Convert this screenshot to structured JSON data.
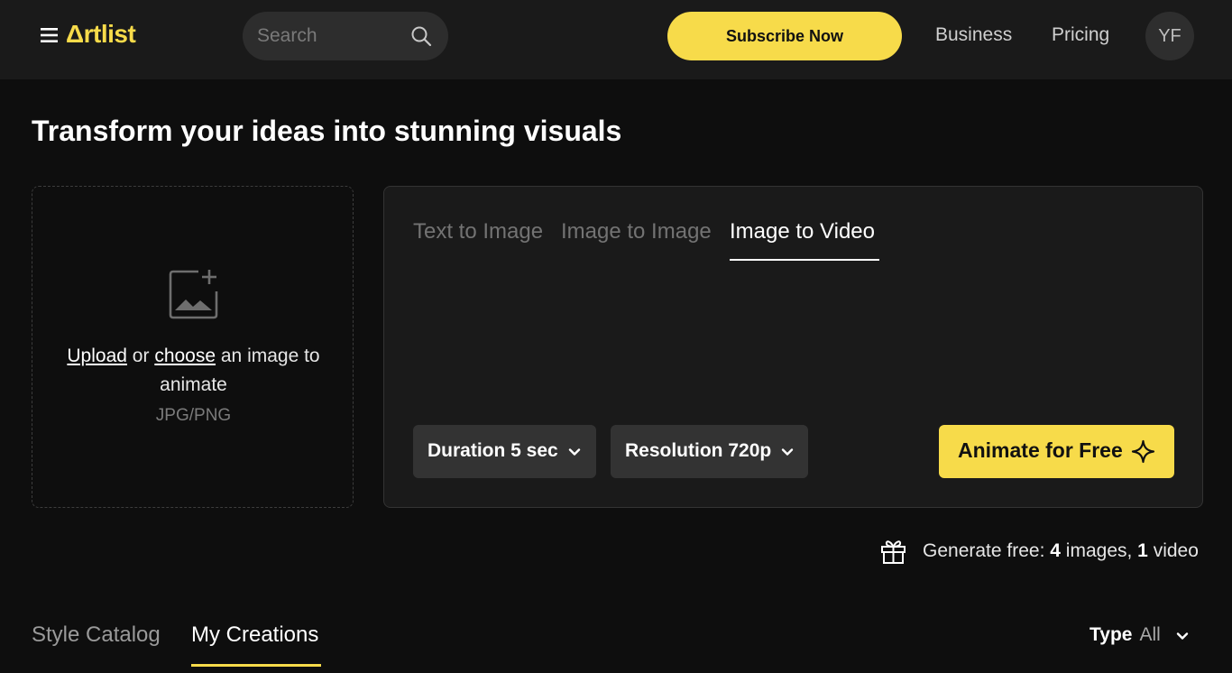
{
  "header": {
    "logo": "Δrtlist",
    "search_placeholder": "Search",
    "subscribe_label": "Subscribe Now",
    "nav": [
      "Business",
      "Pricing"
    ],
    "avatar_initials": "YF"
  },
  "page": {
    "title": "Transform your ideas into stunning visuals"
  },
  "upload": {
    "link_upload": "Upload",
    "text_or": "or",
    "link_choose": "choose",
    "text_rest": "an image to animate",
    "formats": "JPG/PNG"
  },
  "panel": {
    "tabs": [
      "Text to Image",
      "Image to Image",
      "Image to Video"
    ],
    "active_tab": "Image to Video",
    "duration_label": "Duration 5 sec",
    "resolution_label": "Resolution 720p",
    "animate_label": "Animate for Free"
  },
  "free_info": {
    "prefix": "Generate free:",
    "images_count": "4",
    "images_label": "images,",
    "videos_count": "1",
    "videos_label": "video"
  },
  "bottom": {
    "tabs": [
      "Style Catalog",
      "My Creations"
    ],
    "active_tab": "My Creations",
    "type_label": "Type",
    "type_value": "All"
  },
  "colors": {
    "accent": "#f7db4a",
    "background": "#0e0e0e",
    "header_bg": "#1a1a1a"
  },
  "icons": [
    "menu-icon",
    "search-icon",
    "image-add-icon",
    "chevron-down-icon",
    "sparkle-icon",
    "gift-icon"
  ]
}
